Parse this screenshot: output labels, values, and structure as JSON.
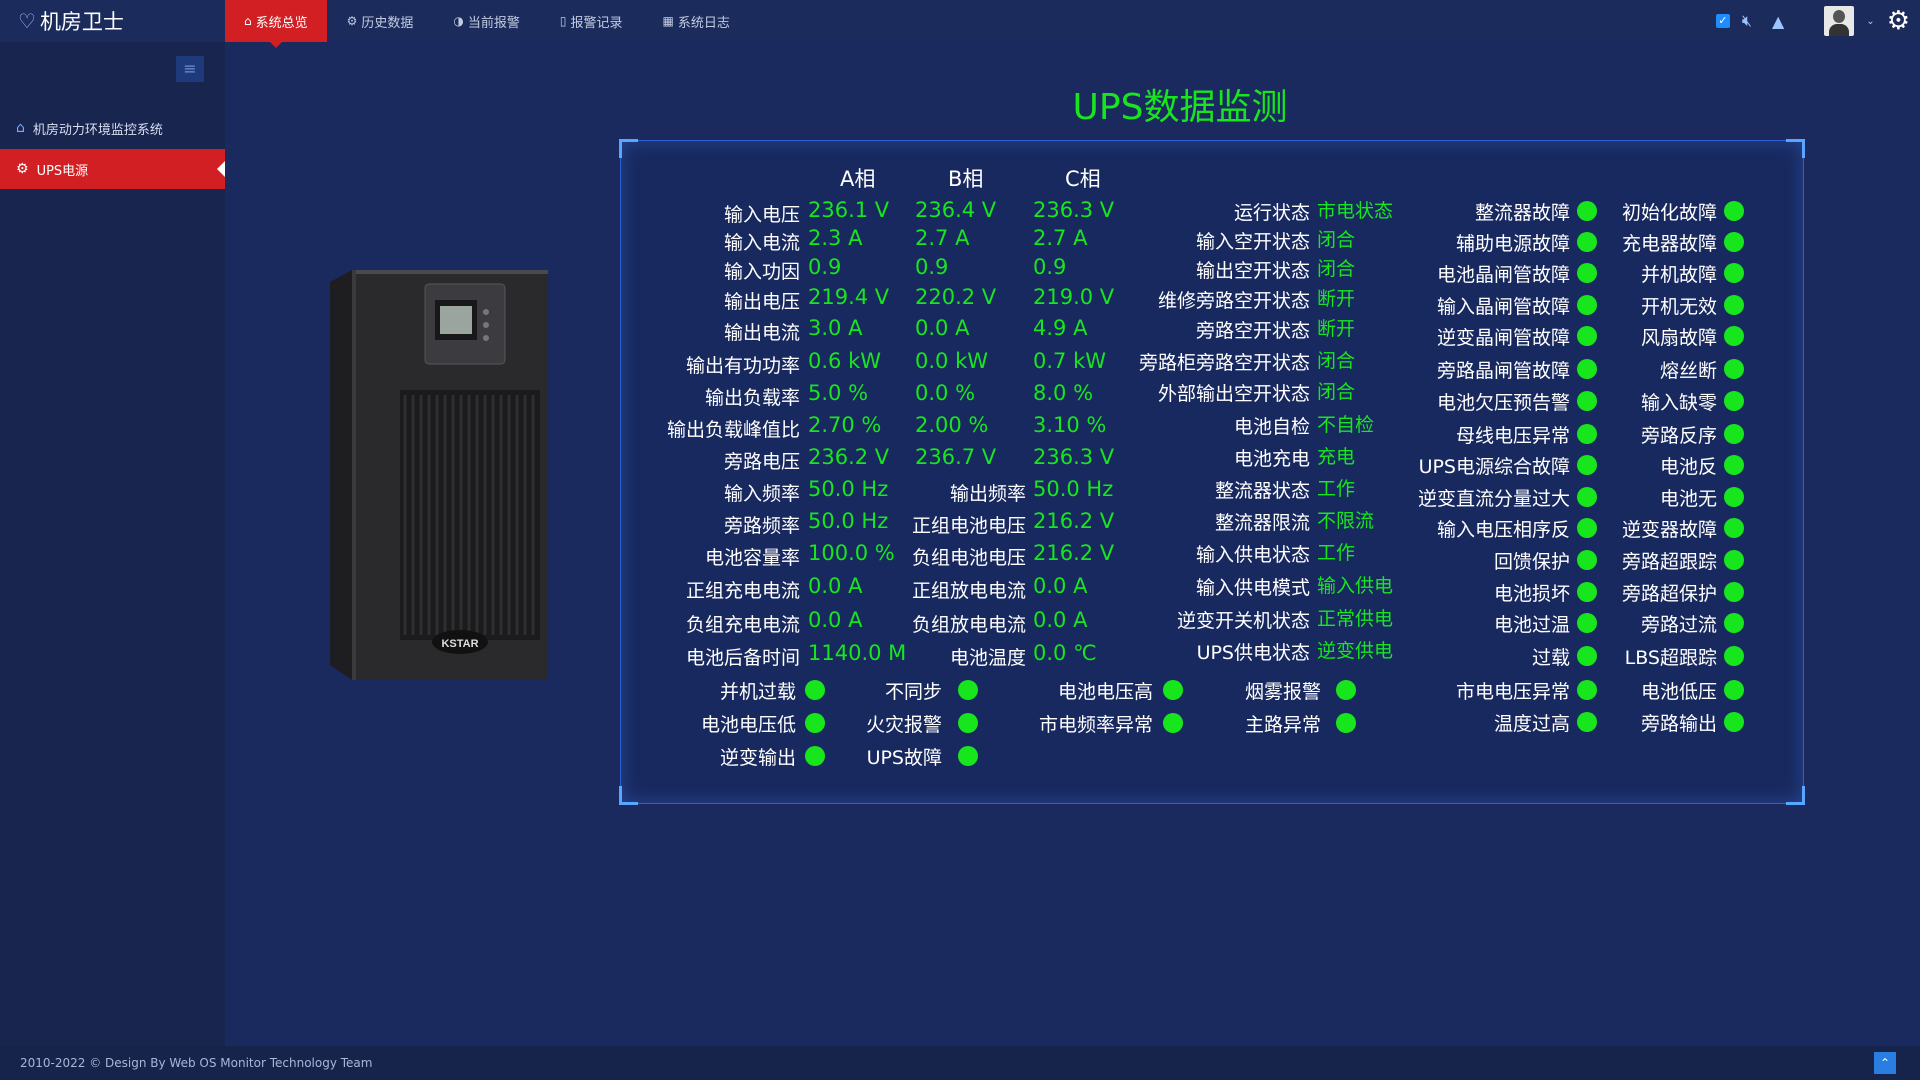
{
  "app": {
    "brand": "机房卫士"
  },
  "nav": {
    "tabs": [
      {
        "label": "系统总览",
        "icon": "home-icon",
        "active": true
      },
      {
        "label": "历史数据",
        "icon": "cogs-icon",
        "active": false
      },
      {
        "label": "当前报警",
        "icon": "half-circle-icon",
        "active": false
      },
      {
        "label": "报警记录",
        "icon": "bookmark-icon",
        "active": false
      },
      {
        "label": "系统日志",
        "icon": "table-icon",
        "active": false
      }
    ]
  },
  "sidebar": {
    "items": [
      {
        "label": "机房动力环境监控系统",
        "icon": "home-icon",
        "active": false
      },
      {
        "label": "UPS电源",
        "icon": "cogs-icon",
        "active": true
      }
    ]
  },
  "page": {
    "title": "UPS数据监测"
  },
  "device": {
    "brand_text": "KSTAR"
  },
  "phase_table": {
    "headers": [
      "A相",
      "B相",
      "C相"
    ],
    "rows": [
      {
        "label": "输入电压",
        "a": "236.1 V",
        "b": "236.4 V",
        "c": "236.3 V"
      },
      {
        "label": "输入电流",
        "a": "2.3 A",
        "b": "2.7 A",
        "c": "2.7 A"
      },
      {
        "label": "输入功因",
        "a": "0.9",
        "b": "0.9",
        "c": "0.9"
      },
      {
        "label": "输出电压",
        "a": "219.4 V",
        "b": "220.2 V",
        "c": "219.0 V"
      },
      {
        "label": "输出电流",
        "a": "3.0 A",
        "b": "0.0 A",
        "c": "4.9 A"
      },
      {
        "label": "输出有功功率",
        "a": "0.6 kW",
        "b": "0.0 kW",
        "c": "0.7 kW"
      },
      {
        "label": "输出负载率",
        "a": "5.0 %",
        "b": "0.0 %",
        "c": "8.0 %"
      },
      {
        "label": "输出负载峰值比",
        "a": "2.70 %",
        "b": "2.00 %",
        "c": "3.10 %"
      },
      {
        "label": "旁路电压",
        "a": "236.2 V",
        "b": "236.7 V",
        "c": "236.3 V"
      }
    ]
  },
  "pair_rows": [
    {
      "l1": "输入频率",
      "v1": "50.0 Hz",
      "l2": "输出频率",
      "v2": "50.0 Hz"
    },
    {
      "l1": "旁路频率",
      "v1": "50.0 Hz",
      "l2": "正组电池电压",
      "v2": "216.2 V"
    },
    {
      "l1": "电池容量率",
      "v1": "100.0 %",
      "l2": "负组电池电压",
      "v2": "216.2 V"
    },
    {
      "l1": "正组充电电流",
      "v1": "0.0 A",
      "l2": "正组放电电流",
      "v2": "0.0 A"
    },
    {
      "l1": "负组充电电流",
      "v1": "0.0 A",
      "l2": "负组放电电流",
      "v2": "0.0 A"
    },
    {
      "l1": "电池后备时间",
      "v1": "1140.0 M",
      "l2": "电池温度",
      "v2": "0.0 ℃"
    }
  ],
  "status_list": [
    {
      "label": "运行状态",
      "value": "市电状态"
    },
    {
      "label": "输入空开状态",
      "value": "闭合"
    },
    {
      "label": "输出空开状态",
      "value": "闭合"
    },
    {
      "label": "维修旁路空开状态",
      "value": "断开"
    },
    {
      "label": "旁路空开状态",
      "value": "断开"
    },
    {
      "label": "旁路柜旁路空开状态",
      "value": "闭合"
    },
    {
      "label": "外部输出空开状态",
      "value": "闭合"
    },
    {
      "label": "电池自检",
      "value": "不自检"
    },
    {
      "label": "电池充电",
      "value": "充电"
    },
    {
      "label": "整流器状态",
      "value": "工作"
    },
    {
      "label": "整流器限流",
      "value": "不限流"
    },
    {
      "label": "输入供电状态",
      "value": "工作"
    },
    {
      "label": "输入供电模式",
      "value": "输入供电"
    },
    {
      "label": "逆变开关机状态",
      "value": "正常供电"
    },
    {
      "label": "UPS供电状态",
      "value": "逆变供电"
    }
  ],
  "alarms_col1": [
    "整流器故障",
    "辅助电源故障",
    "电池晶闸管故障",
    "输入晶闸管故障",
    "逆变晶闸管故障",
    "旁路晶闸管故障",
    "电池欠压预告警",
    "母线电压异常",
    "UPS电源综合故障",
    "逆变直流分量过大",
    "输入电压相序反",
    "回馈保护",
    "电池损坏",
    "电池过温",
    "过载",
    "市电电压异常",
    "温度过高"
  ],
  "alarms_col2": [
    "初始化故障",
    "充电器故障",
    "并机故障",
    "开机无效",
    "风扇故障",
    "熔丝断",
    "输入缺零",
    "旁路反序",
    "电池反",
    "电池无",
    "逆变器故障",
    "旁路超跟踪",
    "旁路超保护",
    "旁路过流",
    "LBS超跟踪",
    "电池低压",
    "旁路输出"
  ],
  "bottom_alarms": [
    [
      "并机过载",
      "不同步",
      "电池电压高",
      "烟雾报警"
    ],
    [
      "电池电压低",
      "火灾报警",
      "市电频率异常",
      "主路异常"
    ],
    [
      "逆变输出",
      "UPS故障"
    ]
  ],
  "colors": {
    "ok": "#18e61d",
    "accent": "#d21f24",
    "bg": "#1a2a5e"
  },
  "footer": {
    "text": "2010-2022 © Design By Web OS Monitor Technology Team"
  }
}
